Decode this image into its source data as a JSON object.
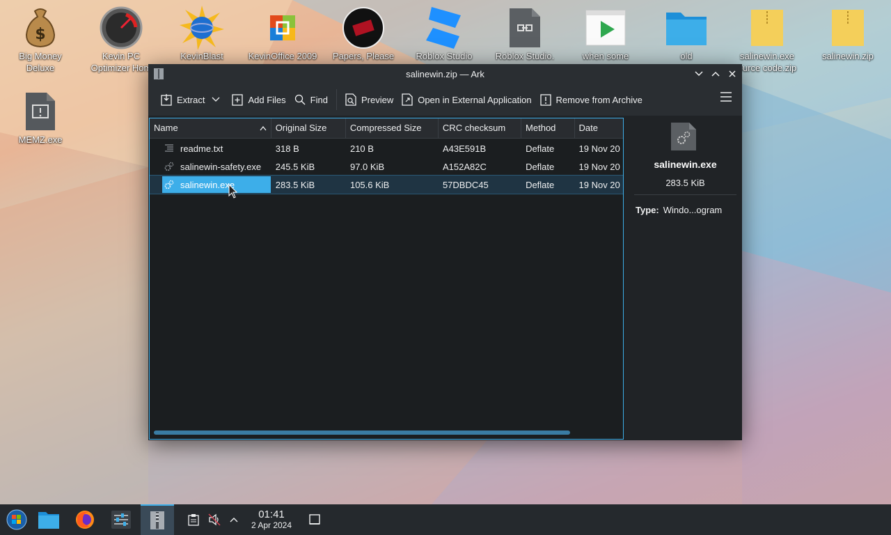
{
  "desktop": {
    "icons": [
      {
        "label_1": "Big Money",
        "label_2": "Deluxe",
        "icon": "money-bag-icon"
      },
      {
        "label_1": "Kevin PC",
        "label_2": "Optimizer Hom",
        "icon": "gauge-icon"
      },
      {
        "label_1": "KevinBlast",
        "icon": "globe-burst-icon"
      },
      {
        "label_1": "KevinOffice 2009",
        "icon": "office-logo-icon"
      },
      {
        "label_1": "Papers, Please",
        "icon": "papers-please-icon"
      },
      {
        "label_1": "Roblox Studio",
        "icon": "roblox-studio-icon"
      },
      {
        "label_1": "Roblox Studio.",
        "icon": "file-link-icon"
      },
      {
        "label_1": "when some",
        "icon": "video-file-icon"
      },
      {
        "label_1": "old",
        "icon": "folder-icon"
      },
      {
        "label_1": "salinewin.exe",
        "label_2": "ource code.zip",
        "icon": "zip-icon"
      },
      {
        "label_1": "salinewin.zip",
        "icon": "zip-icon"
      },
      {
        "label_1": "MEMZ.exe",
        "icon": "exe-warning-icon"
      }
    ]
  },
  "window": {
    "title": "salinewin.zip — Ark",
    "toolbar": {
      "extract": "Extract",
      "add_files": "Add Files",
      "find": "Find",
      "preview": "Preview",
      "open_external": "Open in External Application",
      "remove": "Remove from Archive"
    },
    "columns": [
      "Name",
      "Original Size",
      "Compressed Size",
      "CRC checksum",
      "Method",
      "Date"
    ],
    "rows": [
      {
        "name": "readme.txt",
        "original": "318 B",
        "compressed": "210 B",
        "crc": "A43E591B",
        "method": "Deflate",
        "date": "19 Nov 20",
        "icon": "text-file-icon",
        "selected": false
      },
      {
        "name": "salinewin-safety.exe",
        "original": "245.5 KiB",
        "compressed": "97.0 KiB",
        "crc": "A152A82C",
        "method": "Deflate",
        "date": "19 Nov 20",
        "icon": "executable-icon",
        "selected": false
      },
      {
        "name": "salinewin.exe",
        "original": "283.5 KiB",
        "compressed": "105.6 KiB",
        "crc": "57DBDC45",
        "method": "Deflate",
        "date": "19 Nov 20",
        "icon": "executable-icon",
        "selected": true
      }
    ],
    "details": {
      "filename": "salinewin.exe",
      "size": "283.5 KiB",
      "type_label": "Type:",
      "type_value": "Windo...ogram"
    }
  },
  "taskbar": {
    "time": "01:41",
    "date": "2 Apr 2024"
  },
  "colors": {
    "accent": "#3daee9",
    "window_bg": "#202326",
    "taskbar_bg": "#25292d"
  }
}
